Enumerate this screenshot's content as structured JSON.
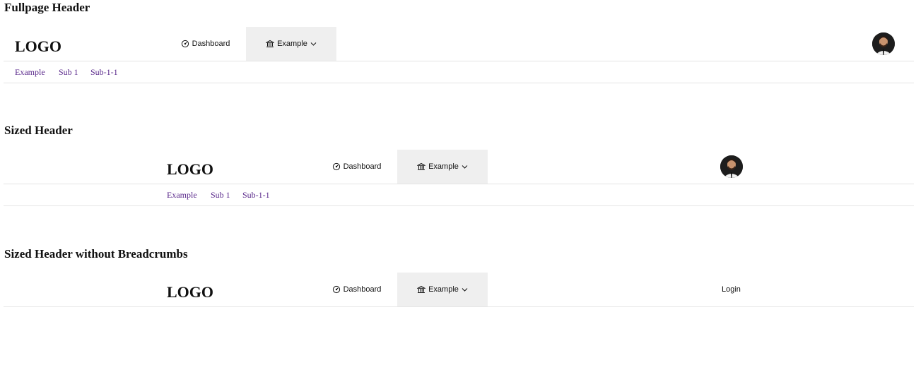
{
  "sections": [
    {
      "title": "Fullpage Header",
      "logo": "LOGO",
      "nav": [
        {
          "label": "Dashboard",
          "icon": "dashboard-gauge-icon"
        },
        {
          "label": "Example",
          "icon": "bank-icon",
          "dropdown": true,
          "active": true
        }
      ],
      "user": {
        "type": "avatar"
      },
      "breadcrumbs": [
        "Example",
        "Sub 1",
        "Sub-1-1"
      ]
    },
    {
      "title": "Sized Header",
      "logo": "LOGO",
      "nav": [
        {
          "label": "Dashboard",
          "icon": "dashboard-gauge-icon"
        },
        {
          "label": "Example",
          "icon": "bank-icon",
          "dropdown": true,
          "active": true
        }
      ],
      "user": {
        "type": "avatar"
      },
      "breadcrumbs": [
        "Example",
        "Sub 1",
        "Sub-1-1"
      ]
    },
    {
      "title": "Sized Header without Breadcrumbs",
      "logo": "LOGO",
      "nav": [
        {
          "label": "Dashboard",
          "icon": "dashboard-gauge-icon"
        },
        {
          "label": "Example",
          "icon": "bank-icon",
          "dropdown": true,
          "active": true
        }
      ],
      "user": {
        "type": "login",
        "label": "Login"
      }
    }
  ],
  "colors": {
    "active_nav_bg": "#efefef",
    "breadcrumb_link": "#5b2a8c",
    "divider": "#e4e4e4"
  }
}
